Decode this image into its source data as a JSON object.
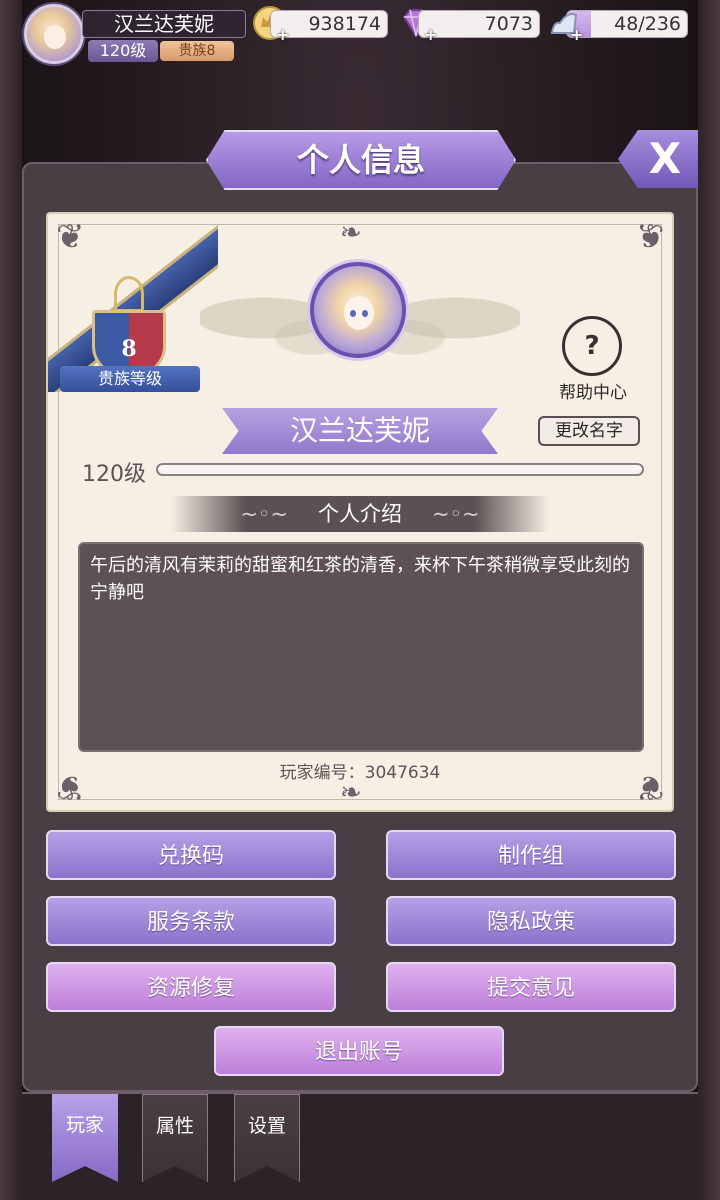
{
  "topbar": {
    "player_name": "汉兰达芙妮",
    "level": "120级",
    "noble": "贵族8",
    "coins": "938174",
    "gems": "7073",
    "energy": "48/236",
    "energy_fraction": 0.2
  },
  "panel": {
    "title": "个人信息",
    "close_label": "X"
  },
  "profile": {
    "noble_level_number": "8",
    "noble_level_label": "贵族等级",
    "help_label": "帮助中心",
    "help_icon_glyph": "?",
    "name": "汉兰达芙妮",
    "rename_label": "更改名字",
    "level": "120级",
    "exp_fraction": 0,
    "intro_heading": "个人介绍",
    "intro_text": "午后的清风有茉莉的甜蜜和红茶的清香，来杯下午茶稍微享受此刻的宁静吧",
    "player_id": "玩家编号：3047634"
  },
  "buttons": {
    "redeem": "兑换码",
    "credits": "制作组",
    "terms": "服务条款",
    "privacy": "隐私政策",
    "repair": "资源修复",
    "feedback": "提交意见",
    "logout": "退出账号"
  },
  "tabs": [
    {
      "label": "玩家",
      "active": true
    },
    {
      "label": "属性",
      "active": false
    },
    {
      "label": "设置",
      "active": false
    }
  ],
  "colors": {
    "accent_purple": "#9278cc",
    "accent_pink": "#bd7fd9",
    "panel_bg": "#4a3e45",
    "card_bg": "#f6f0e4"
  }
}
